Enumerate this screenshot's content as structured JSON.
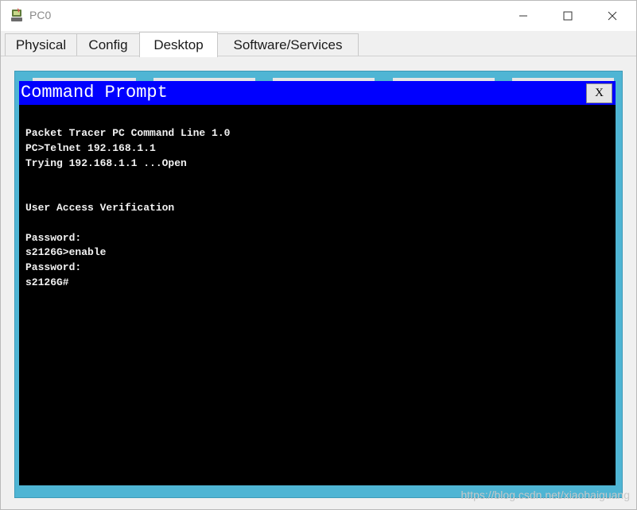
{
  "window": {
    "title": "PC0"
  },
  "tabs": [
    {
      "label": "Physical"
    },
    {
      "label": "Config"
    },
    {
      "label": "Desktop",
      "active": true
    },
    {
      "label": "Software/Services"
    }
  ],
  "command_prompt": {
    "title": "Command Prompt",
    "close_label": "X",
    "lines": [
      "Packet Tracer PC Command Line 1.0",
      "PC>Telnet 192.168.1.1",
      "Trying 192.168.1.1 ...Open",
      "",
      "",
      "User Access Verification",
      "",
      "Password:",
      "s2126G>enable",
      "Password:",
      "s2126G#"
    ]
  },
  "watermark": "https://blog.csdn.net/xiaohaiguang",
  "colors": {
    "cmd_title_bar": "#0000ff",
    "cmd_background": "#000000",
    "desktop_background": "#4fb5d4"
  }
}
